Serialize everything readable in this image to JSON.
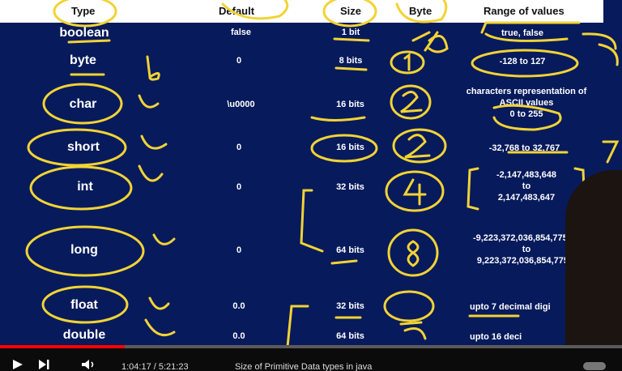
{
  "header": {
    "type": "Type",
    "default": "Default",
    "size": "Size",
    "byte": "Byte",
    "range": "Range of values"
  },
  "rows": [
    {
      "type": "boolean",
      "default": "false",
      "size": "1 bit",
      "range": "true, false"
    },
    {
      "type": "byte",
      "default": "0",
      "size": "8 bits",
      "range": "-128 to 127"
    },
    {
      "type": "char",
      "default": "\\u0000",
      "size": "16 bits",
      "range": "characters representation of ASCII values 0 to 255"
    },
    {
      "type": "short",
      "default": "0",
      "size": "16 bits",
      "range": "-32,768 to 32,767"
    },
    {
      "type": "int",
      "default": "0",
      "size": "32 bits",
      "range": "-2,147,483,648 to 2,147,483,647"
    },
    {
      "type": "long",
      "default": "0",
      "size": "64 bits",
      "range": "-9,223,372,036,854,775,80 to 9,223,372,036,854,775,8"
    },
    {
      "type": "float",
      "default": "0.0",
      "size": "32 bits",
      "range": "upto 7 decimal digi"
    },
    {
      "type": "double",
      "default": "0.0",
      "size": "64 bits",
      "range": "upto 16 deci"
    }
  ],
  "range_lines": {
    "char": [
      "characters representation of",
      "ASCII values",
      "0 to 255"
    ],
    "int": [
      "-2,147,483,648",
      "to",
      "2,147,483,647"
    ],
    "long": [
      "-9,223,372,036,854,775,80",
      "to",
      "9,223,372,036,854,775,8"
    ]
  },
  "player": {
    "time": "1:04:17 / 5:21:23",
    "title": "Size of Primitive Data types in java",
    "progress_fraction": 0.2
  },
  "colors": {
    "slide_bg": "#071a5c",
    "annotation": "#f2d335",
    "progress": "#ff0000"
  }
}
